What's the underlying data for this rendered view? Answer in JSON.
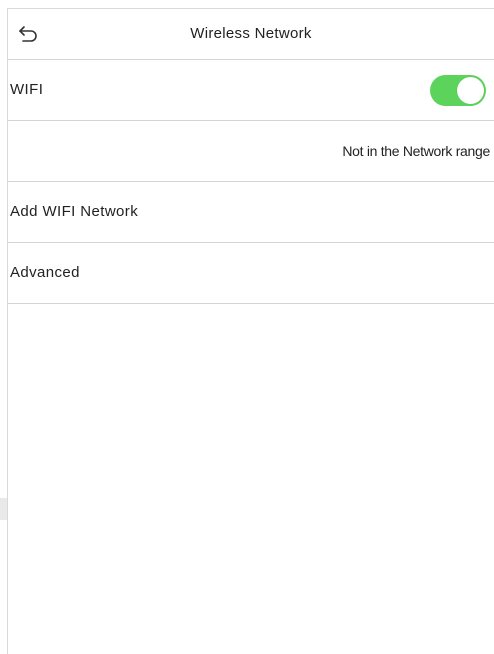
{
  "header": {
    "title": "Wireless Network",
    "back_icon": "back-arrow-icon"
  },
  "wifi": {
    "label": "WIFI",
    "enabled": true,
    "toggle_color": "#5cd35a"
  },
  "network_status": {
    "text": "Not in the Network range"
  },
  "menu": {
    "add_wifi_label": "Add WIFI Network",
    "advanced_label": "Advanced"
  }
}
